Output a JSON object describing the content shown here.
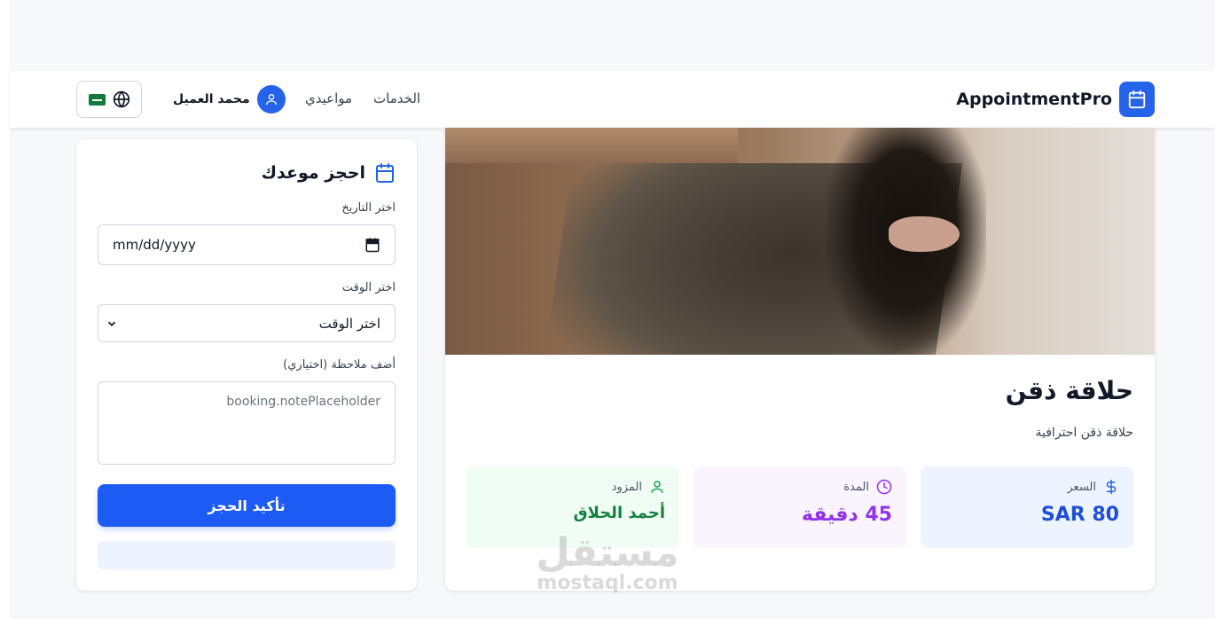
{
  "header": {
    "brand": "AppointmentPro",
    "nav": {
      "services": "الخدمات",
      "appointments": "مواعيدي"
    },
    "user_name": "محمد العميل"
  },
  "service": {
    "title": "حلاقة ذقن",
    "description": "حلاقة ذقن احترافية",
    "price_label": "السعر",
    "price_value": "SAR 80",
    "duration_label": "المدة",
    "duration_value": "45 دقيقة",
    "provider_label": "المزود",
    "provider_value": "أحمد الحلاق"
  },
  "booking": {
    "title": "احجز موعدك",
    "date_label": "اختر التاريخ",
    "date_value": "mm/dd/yyyy",
    "time_label": "اختر الوقت",
    "time_value": "اختر الوقت",
    "note_label": "أضف ملاحظة (اختياري)",
    "note_placeholder": "booking.notePlaceholder",
    "confirm_label": "تأكيد الحجز"
  },
  "watermark": {
    "arabic": "مستقل",
    "latin": "mostaql.com"
  },
  "colors": {
    "primary": "#2563eb",
    "price": "#1d4ed8",
    "duration": "#9333ea",
    "provider": "#15803d"
  }
}
